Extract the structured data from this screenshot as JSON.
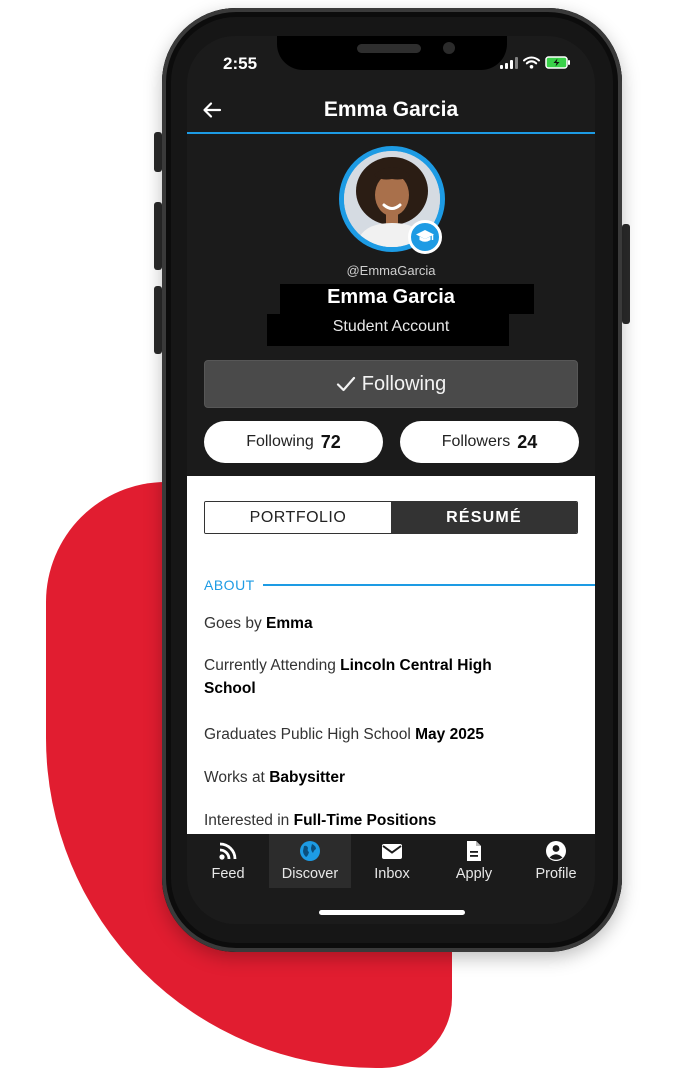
{
  "status": {
    "time": "2:55"
  },
  "header": {
    "title": "Emma Garcia"
  },
  "profile": {
    "handle": "@EmmaGarcia",
    "name": "Emma Garcia",
    "account_type": "Student Account",
    "follow_button": "Following",
    "following_label": "Following",
    "following_count": "72",
    "followers_label": "Followers",
    "followers_count": "24"
  },
  "tabs": {
    "portfolio": "PORTFOLIO",
    "resume": "RÉSUMÉ",
    "active": "resume"
  },
  "about": {
    "section_label": "ABOUT",
    "fields": [
      {
        "label": "Goes by",
        "value": "Emma"
      },
      {
        "label": "Currently Attending",
        "value": "Lincoln Central High School"
      },
      {
        "label": "Graduates Public High School",
        "value": "May 2025"
      },
      {
        "label": "Works at",
        "value": "Babysitter"
      },
      {
        "label": "Interested in",
        "value": "Full-Time Positions"
      }
    ]
  },
  "nav": [
    {
      "label": "Feed",
      "icon": "rss-icon"
    },
    {
      "label": "Discover",
      "icon": "globe-icon"
    },
    {
      "label": "Inbox",
      "icon": "mail-icon"
    },
    {
      "label": "Apply",
      "icon": "document-icon"
    },
    {
      "label": "Profile",
      "icon": "user-circle-icon"
    }
  ],
  "colors": {
    "accent": "#1d9be4",
    "brand_red": "#e11d30",
    "dark_bg": "#1b1b1b"
  }
}
